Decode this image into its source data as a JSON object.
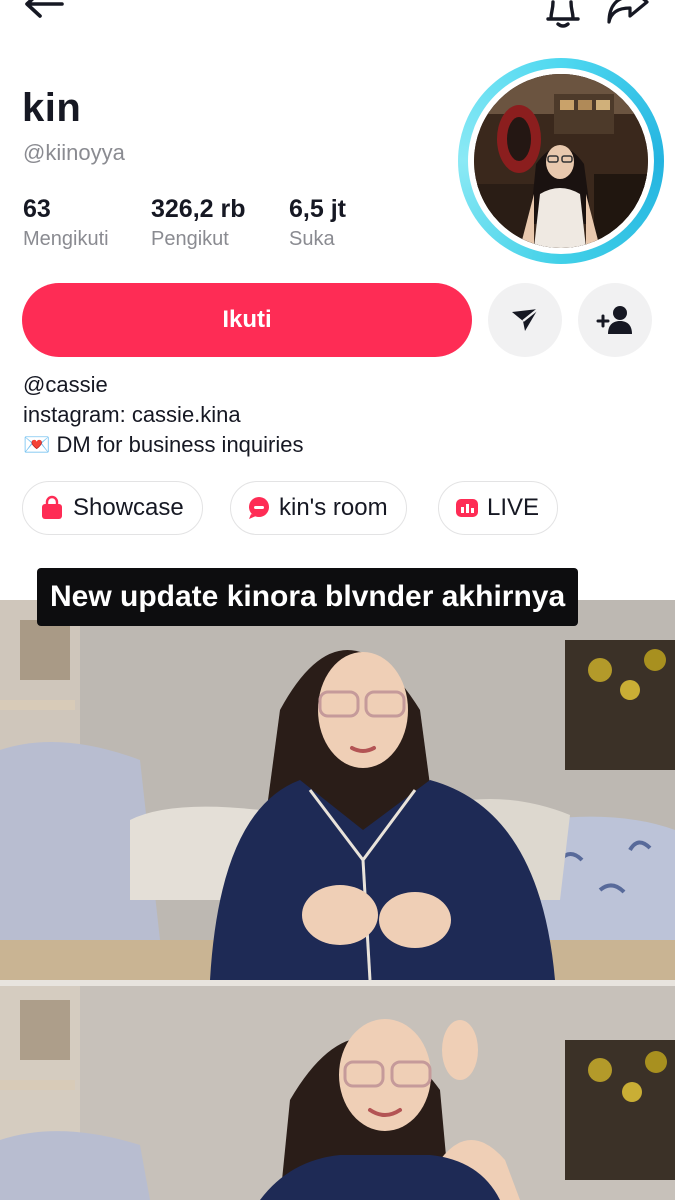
{
  "profile": {
    "display_name": "kin",
    "username": "@kiinoyya"
  },
  "stats": [
    {
      "value": "63",
      "label": "Mengikuti"
    },
    {
      "value": "326,2 rb",
      "label": "Pengikut"
    },
    {
      "value": "6,5 jt",
      "label": "Suka"
    }
  ],
  "actions": {
    "follow_label": "Ikuti",
    "message_icon": "send-icon",
    "suggest_icon": "add-user-icon"
  },
  "bio": {
    "line1": "@cassie",
    "line2": "instagram: cassie.kina",
    "line3": "💌 DM for business inquiries"
  },
  "chips": [
    {
      "label": "Showcase",
      "icon": "shopping-bag-icon",
      "color": "#fe2c55"
    },
    {
      "label": "kin's room",
      "icon": "chat-bubble-icon",
      "color": "#fe2c55"
    },
    {
      "label": "LIVE",
      "icon": "live-icon",
      "color": "#fe2c55"
    }
  ],
  "video": {
    "caption": "New update kinora blvnder akhirnya"
  },
  "colors": {
    "accent": "#fe2c55",
    "avatar_ring": "#3cc8e8",
    "secondary_text": "#8a8b91"
  }
}
